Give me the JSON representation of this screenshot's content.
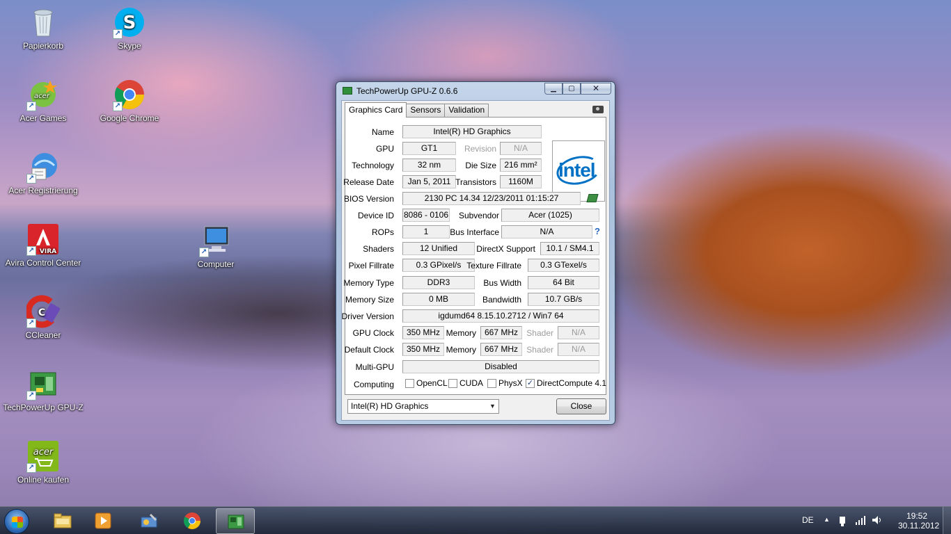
{
  "desktop_icons": [
    {
      "label": "Papierkorb",
      "icon": "recycle-bin-icon"
    },
    {
      "label": "Skype",
      "icon": "skype-icon"
    },
    {
      "label": "Acer Games",
      "icon": "acer-games-icon"
    },
    {
      "label": "Google Chrome",
      "icon": "chrome-icon"
    },
    {
      "label": "Acer Registrierung",
      "icon": "acer-registration-icon"
    },
    {
      "label": "Avira Control Center",
      "icon": "avira-icon"
    },
    {
      "label": "Computer",
      "icon": "computer-icon"
    },
    {
      "label": "CCleaner",
      "icon": "ccleaner-icon"
    },
    {
      "label": "TechPowerUp GPU-Z",
      "icon": "gpuz-icon"
    },
    {
      "label": "Online kaufen",
      "icon": "acer-shop-icon"
    }
  ],
  "icon_texts": {
    "skype": "S",
    "avira": "VIRA",
    "acer": "acer",
    "ccleaner": "C"
  },
  "window": {
    "title": "TechPowerUp GPU-Z 0.6.6",
    "controls": {
      "minimize": "▁",
      "maximize": "▢",
      "close": "✕"
    },
    "tabs": [
      "Graphics Card",
      "Sensors",
      "Validation"
    ],
    "logo_text": "intel",
    "fields": {
      "name_label": "Name",
      "name": "Intel(R) HD Graphics",
      "gpu_label": "GPU",
      "gpu": "GT1",
      "revision_label": "Revision",
      "revision": "N/A",
      "technology_label": "Technology",
      "technology": "32 nm",
      "die_size_label": "Die Size",
      "die_size": "216 mm²",
      "release_date_label": "Release Date",
      "release_date": "Jan 5, 2011",
      "transistors_label": "Transistors",
      "transistors": "1160M",
      "bios_label": "BIOS Version",
      "bios": "2130 PC 14.34  12/23/2011  01:15:27",
      "device_id_label": "Device ID",
      "device_id": "8086 - 0106",
      "subvendor_label": "Subvendor",
      "subvendor": "Acer (1025)",
      "rops_label": "ROPs",
      "rops": "1",
      "bus_interface_label": "Bus Interface",
      "bus_interface": "N/A",
      "help": "?",
      "shaders_label": "Shaders",
      "shaders": "12 Unified",
      "directx_label": "DirectX Support",
      "directx": "10.1 / SM4.1",
      "pixel_fillrate_label": "Pixel Fillrate",
      "pixel_fillrate": "0.3 GPixel/s",
      "texture_fillrate_label": "Texture Fillrate",
      "texture_fillrate": "0.3 GTexel/s",
      "memory_type_label": "Memory Type",
      "memory_type": "DDR3",
      "bus_width_label": "Bus Width",
      "bus_width": "64 Bit",
      "memory_size_label": "Memory Size",
      "memory_size": "0 MB",
      "bandwidth_label": "Bandwidth",
      "bandwidth": "10.7 GB/s",
      "driver_label": "Driver Version",
      "driver": "igdumd64 8.15.10.2712 / Win7 64",
      "gpu_clock_label": "GPU Clock",
      "gpu_clock": "350 MHz",
      "memory_label": "Memory",
      "memory_clock": "667 MHz",
      "shader_label": "Shader",
      "shader_clock": "N/A",
      "default_clock_label": "Default Clock",
      "default_clock": "350 MHz",
      "default_memory_clock": "667 MHz",
      "default_shader_clock": "N/A",
      "multi_gpu_label": "Multi-GPU",
      "multi_gpu": "Disabled",
      "computing_label": "Computing"
    },
    "computing": [
      {
        "label": "OpenCL",
        "checked": false
      },
      {
        "label": "CUDA",
        "checked": false
      },
      {
        "label": "PhysX",
        "checked": false
      },
      {
        "label": "DirectCompute 4.1",
        "checked": true
      }
    ],
    "check_mark": "✓",
    "device_select": "Intel(R) HD Graphics",
    "select_arrow": "▼",
    "close_button": "Close"
  },
  "taskbar": {
    "items": [
      "explorer-icon",
      "media-player-icon",
      "control-panel-icon",
      "chrome-icon",
      "gpuz-icon"
    ],
    "language": "DE",
    "tray_expand": "▲",
    "time": "19:52",
    "date": "30.11.2012"
  }
}
